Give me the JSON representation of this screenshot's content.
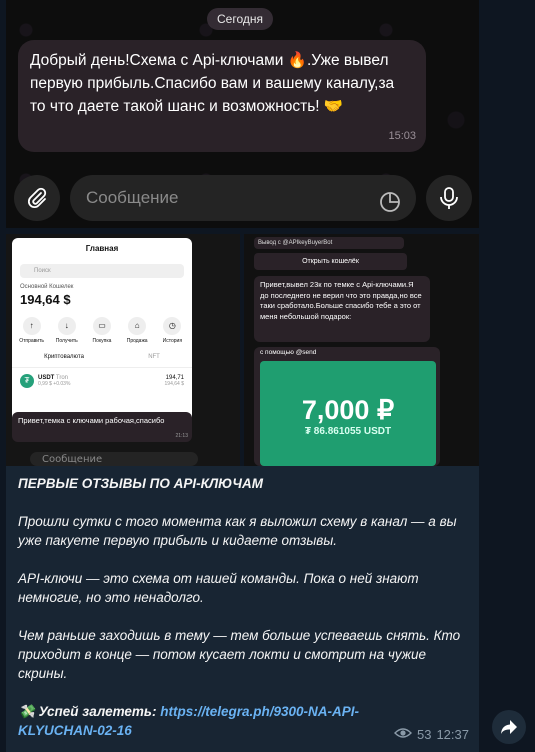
{
  "top_screenshot": {
    "date": "Сегодня",
    "message_text": "Добрый день!Схема с Api-ключами 🔥.Уже вывел первую прибыль.Спасибо вам и вашему каналу,за то что даете такой шанс и возможность! 🤝",
    "message_time": "15:03",
    "input_placeholder": "Сообщение"
  },
  "wallet_screenshot": {
    "header_title": "Главная",
    "search_placeholder": "Поиск",
    "wallet_name": "Основной Кошелек",
    "balance": "194,64 $",
    "actions": [
      "Отправить",
      "Получить",
      "Покупка",
      "Продажа",
      "История"
    ],
    "tabs": [
      "Криптовалюта",
      "NFT"
    ],
    "asset_name": "USDT",
    "asset_network": "Tron",
    "asset_sub": "0,99 $ +0.03%",
    "asset_amount": "194,71",
    "asset_value": "194,64 $",
    "caption": "Привет,темка с ключами рабочая,спасибо",
    "caption_time": "21:13",
    "input_placeholder": "Сообщение"
  },
  "check_screenshot": {
    "top_text": "Вывод с @APIkeyBuyerBot",
    "top_time": "15:26",
    "open_wallet": "Открыть кошелёк",
    "message": "Привет,вывел 23к по темке с Api-ключами.Я до последнего не верил что это правда,но все таки сработало.Больше спасибо тебе а это от меня небольшой подарок:",
    "message_time": "15:31",
    "via": "с помощью @send",
    "amount": "7,000 ₽",
    "amount_usdt": "₮ 86.861055 USDT"
  },
  "post": {
    "title": "ПЕРВЫЕ ОТЗЫВЫ ПО API-КЛЮЧАМ",
    "paragraph1": "Прошли сутки с того момента как я выложил схему в канал  — а вы уже пакуете первую прибыль и кидаете отзывы.",
    "paragraph2": "API-ключи — это схема от нашей команды. Пока о ней знают немногие, но это ненадолго.",
    "paragraph3": "Чем раньше заходишь в тему — тем больше успеваешь снять. Кто приходит в конце — потом кусает локти и смотрит на чужие скрины.",
    "cta_label": "Успей залететь:",
    "cta_link": "https://telegra.ph/9300-NA-API-KLYUCHAN-02-16",
    "views": "53",
    "time": "12:37",
    "money_emoji": "💸"
  },
  "colors": {
    "post_bg": "#182533",
    "link": "#6ab2f2",
    "check_green": "#1f9e70"
  }
}
